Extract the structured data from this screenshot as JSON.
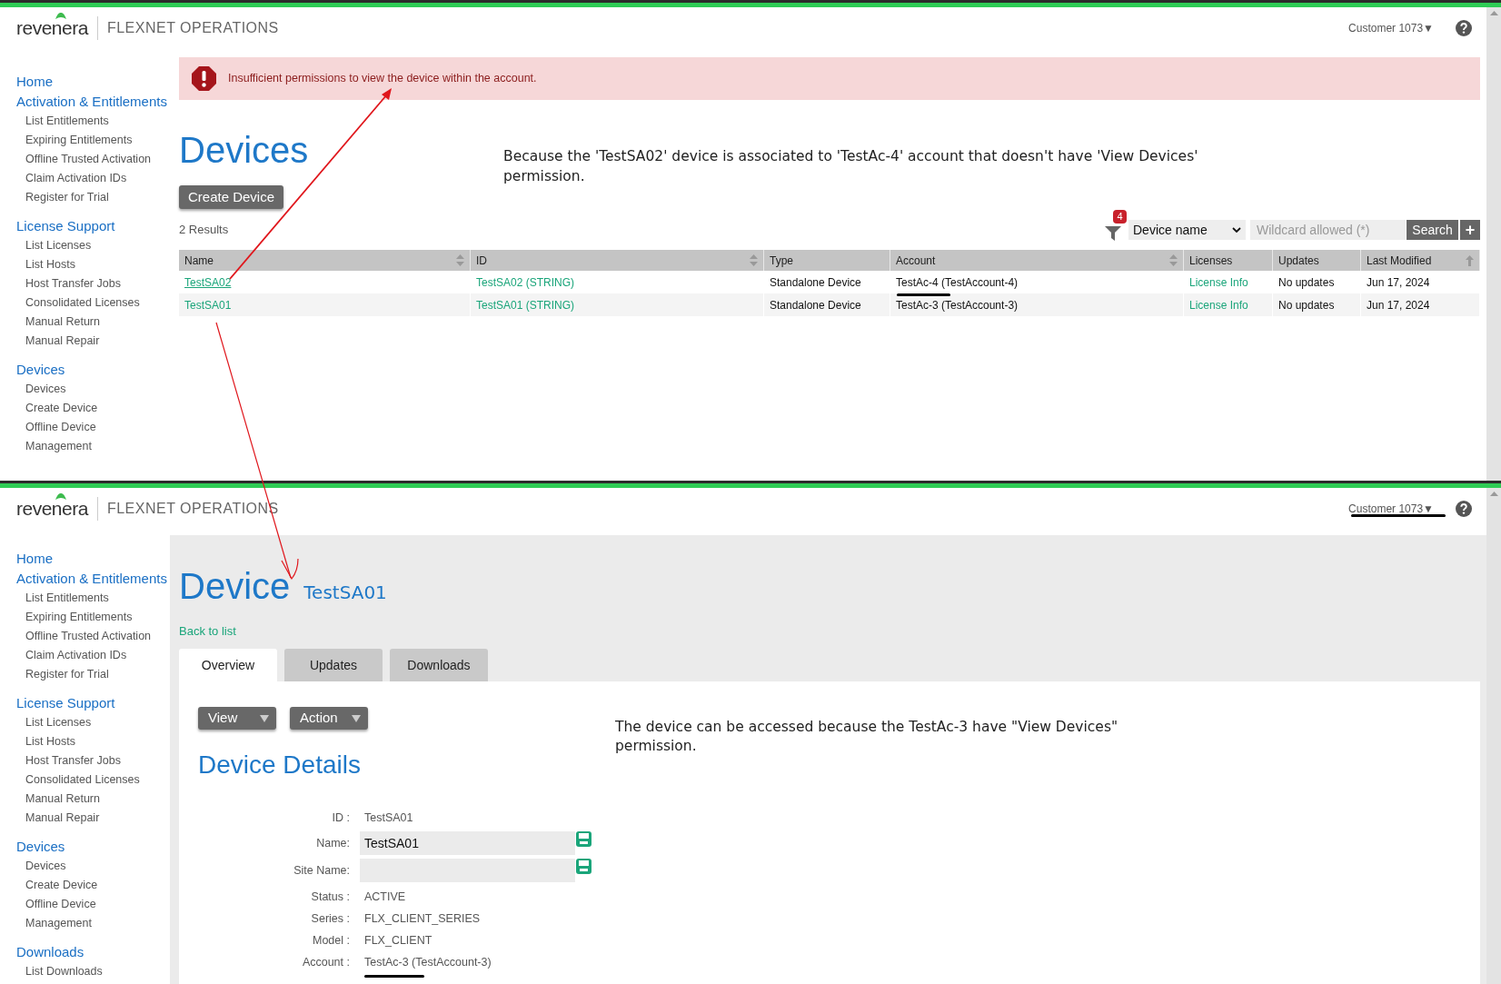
{
  "screens": [
    {
      "header": {
        "logo": "revenera",
        "product": "FLEXNET OPERATIONS",
        "account_menu": "Customer 1073",
        "menu_arrow": "▼"
      },
      "sidebar": [
        {
          "heading": "Home"
        },
        {
          "heading": "Activation & Entitlements",
          "items": [
            "List Entitlements",
            "Expiring Entitlements",
            "Offline Trusted Activation",
            "Claim Activation IDs",
            "Register for Trial"
          ]
        },
        {
          "heading": "License Support",
          "items": [
            "List Licenses",
            "List Hosts",
            "Host Transfer Jobs",
            "Consolidated Licenses",
            "Manual Return",
            "Manual Repair"
          ]
        },
        {
          "heading": "Devices",
          "items": [
            "Devices",
            "Create Device",
            "Offline Device Management"
          ]
        }
      ],
      "alert": "Insufficient permissions to view the device within the account.",
      "title": "Devices",
      "note": "Because the 'TestSA02' device is associated to 'TestAc-4' account that doesn't have 'View Devices' permission.",
      "create_button": "Create Device",
      "results": "2 Results",
      "filter_count": "4",
      "search_by": "Device name",
      "search_placeholder": "Wildcard allowed (*)",
      "search_button": "Search",
      "add_button": "+",
      "table": {
        "columns": [
          {
            "label": "Name",
            "sortable": true,
            "sorted": false,
            "kind": "link"
          },
          {
            "label": "ID",
            "sortable": true,
            "sorted": false,
            "kind": "link"
          },
          {
            "label": "Type",
            "sortable": false,
            "sorted": false,
            "kind": "text"
          },
          {
            "label": "Account",
            "sortable": true,
            "sorted": false,
            "kind": "text"
          },
          {
            "label": "Licenses",
            "sortable": false,
            "sorted": false,
            "kind": "link"
          },
          {
            "label": "Updates",
            "sortable": false,
            "sorted": false,
            "kind": "text"
          },
          {
            "label": "Last Modified",
            "sortable": true,
            "sorted": true,
            "kind": "text"
          }
        ],
        "rows": [
          {
            "hovered": true,
            "cells": [
              "TestSA02",
              "TestSA02 (STRING)",
              "Standalone Device",
              "TestAc-4 (TestAccount-4)",
              "License Info",
              "No updates",
              "Jun 17, 2024"
            ]
          },
          {
            "hovered": false,
            "cells": [
              "TestSA01",
              "TestSA01 (STRING)",
              "Standalone Device",
              "TestAc-3 (TestAccount-3)",
              "License Info",
              "No updates",
              "Jun 17, 2024"
            ]
          }
        ]
      }
    },
    {
      "header": {
        "logo": "revenera",
        "product": "FLEXNET OPERATIONS",
        "account_menu": "Customer 1073",
        "menu_arrow": "▼"
      },
      "sidebar": [
        {
          "heading": "Home"
        },
        {
          "heading": "Activation & Entitlements",
          "items": [
            "List Entitlements",
            "Expiring Entitlements",
            "Offline Trusted Activation",
            "Claim Activation IDs",
            "Register for Trial"
          ]
        },
        {
          "heading": "License Support",
          "items": [
            "List Licenses",
            "List Hosts",
            "Host Transfer Jobs",
            "Consolidated Licenses",
            "Manual Return",
            "Manual Repair"
          ]
        },
        {
          "heading": "Devices",
          "items": [
            "Devices",
            "Create Device",
            "Offline Device Management"
          ]
        },
        {
          "heading": "Downloads",
          "items": [
            "List Downloads"
          ]
        }
      ],
      "title": "Device",
      "subtitle": "TestSA01",
      "back_link": "Back to list",
      "tabs": [
        {
          "label": "Overview",
          "selected": true
        },
        {
          "label": "Updates",
          "selected": false
        },
        {
          "label": "Downloads",
          "selected": false
        }
      ],
      "menu_buttons": [
        "View",
        "Action"
      ],
      "note": "The device can be accessed because the TestAc-3 have \"View Devices\" permission.",
      "section": "Device Details",
      "fields": [
        {
          "label": "ID :",
          "value": "TestSA01",
          "kind": "text"
        },
        {
          "label": "Name:",
          "value": "TestSA01",
          "kind": "input"
        },
        {
          "label": "Site Name:",
          "kind": "input"
        },
        {
          "label": "Status :",
          "value": "ACTIVE",
          "kind": "text"
        },
        {
          "label": "Series :",
          "value": "FLX_CLIENT_SERIES",
          "kind": "text"
        },
        {
          "label": "Model :",
          "value": "FLX_CLIENT",
          "kind": "text"
        },
        {
          "label": "Account :",
          "value": "TestAc-3 (TestAccount-3)",
          "kind": "text"
        }
      ]
    }
  ]
}
